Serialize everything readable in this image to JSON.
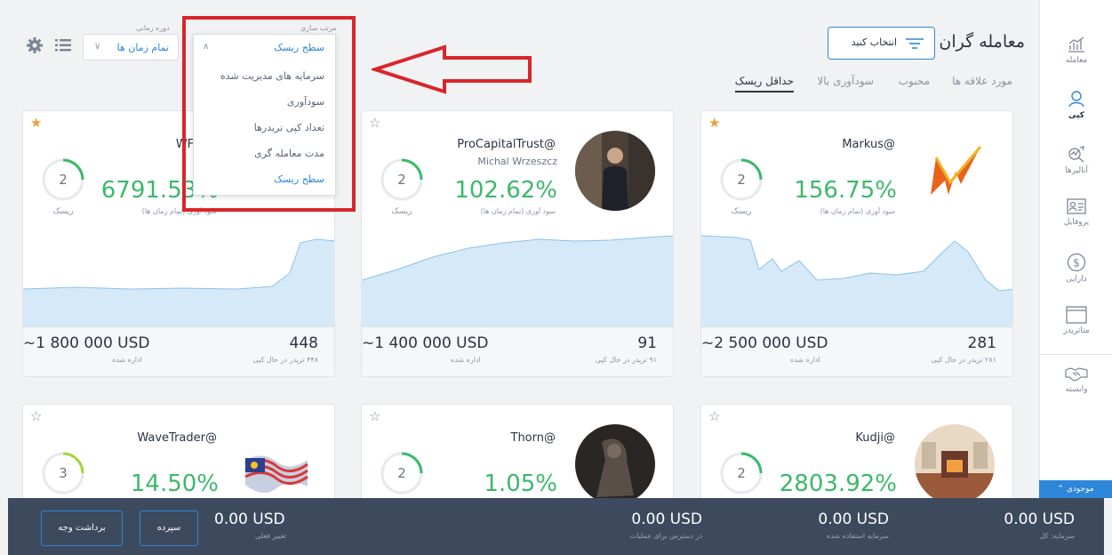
{
  "colors": {
    "accent": "#2d86d8",
    "positive": "#3db86a",
    "star": "#e8a23a",
    "bottom_bar": "#3d4a5e",
    "annotation": "#d9252a"
  },
  "sidebar": {
    "items": [
      {
        "label": "معامله",
        "icon": "trade-chart-icon"
      },
      {
        "label": "کپی",
        "icon": "copy-user-icon"
      },
      {
        "label": "آنالیزها",
        "icon": "analysis-icon"
      },
      {
        "label": "پروفایل",
        "icon": "profile-card-icon"
      },
      {
        "label": "دارایی",
        "icon": "dollar-circle-icon"
      },
      {
        "label": "متاتریدر",
        "icon": "window-icon"
      },
      {
        "label": "وابسته",
        "icon": "handshake-icon"
      }
    ],
    "balance_tab": "موجودی"
  },
  "header": {
    "title": "معامله گران",
    "select_button": "انتخاب کنید",
    "tabs": [
      "مورد علاقه ها",
      "محبوب",
      "سودآوری بالا",
      "حداقل ریسک"
    ],
    "active_tab": "حداقل ریسک"
  },
  "filters": {
    "period_label": "دوره زمانی",
    "period_value": "تمام زمان ها",
    "sort_label": "مرتب سازی",
    "sort_value": "سطح ریسک",
    "sort_options": [
      "سرمایه های مدیریت شده",
      "سودآوری",
      "تعداد کپی تریدرها",
      "مدت معامله گری",
      "سطح ریسک"
    ]
  },
  "cards": [
    {
      "name": "WF_Tra",
      "subtitle": "",
      "percent": "6791.53%",
      "percent_label": "سود آوری (تمام زمان ها)",
      "risk": "2",
      "risk_label": "ریسک",
      "aum": "~1 800 000 USD",
      "aum_label": "اداره شده",
      "copiers": "448",
      "copiers_label": "۴۴۸ تریدر در حال کپی",
      "favorite": true,
      "avatar": "chart-thumbnail"
    },
    {
      "name": "ProCapitalTrust@",
      "subtitle": "Michal Wrzeszcz",
      "percent": "102.62%",
      "percent_label": "سود آوری (تمام زمان ها)",
      "risk": "2",
      "risk_label": "ریسک",
      "aum": "~1 400 000 USD",
      "aum_label": "اداره شده",
      "copiers": "91",
      "copiers_label": "۹۱ تریدر در حال کپی",
      "favorite": false,
      "avatar": "man-in-suit-photo"
    },
    {
      "name": "Markus@",
      "subtitle": "",
      "percent": "156.75%",
      "percent_label": "سود آوری (تمام زمان ها)",
      "risk": "2",
      "risk_label": "ریسک",
      "aum": "~2 500 000 USD",
      "aum_label": "اداره شده",
      "copiers": "281",
      "copiers_label": "۲۸۱ تریدر در حال کپی",
      "favorite": true,
      "avatar": "m-logo"
    },
    {
      "name": "WaveTrader@",
      "subtitle": "",
      "percent": "14.50%",
      "risk": "3",
      "favorite": false,
      "avatar": "flag-wave-chart"
    },
    {
      "name": "Thorn@",
      "subtitle": "",
      "percent": "1.05%",
      "risk": "2",
      "favorite": false,
      "avatar": "dark-figure-photo"
    },
    {
      "name": "Kudji@",
      "subtitle": "",
      "percent": "2803.92%",
      "risk": "2",
      "favorite": false,
      "avatar": "room-interior-photo"
    }
  ],
  "bottom_bar": {
    "total_capital": "0.00 USD",
    "total_capital_label": "سرمایه: کل",
    "used_capital": "0.00 USD",
    "used_capital_label": "سرمایه استفاده شده",
    "available": "0.00 USD",
    "available_label": "در دسترس برای عملیات",
    "current_change": "0.00 USD",
    "current_change_label": "تغییر فعلی",
    "deposit_button": "سپرده",
    "withdraw_button": "برداشت وجه"
  }
}
